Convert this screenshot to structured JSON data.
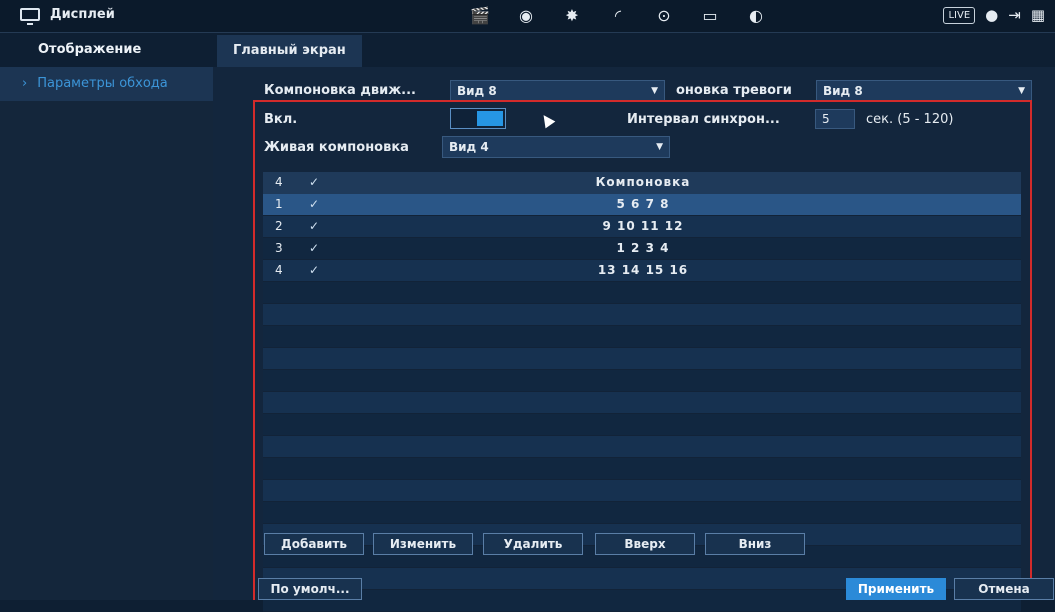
{
  "topbar": {
    "title": "Дисплей",
    "icons": [
      "clapper-icon",
      "face-icon",
      "alarm-icon",
      "speed-icon",
      "record-icon",
      "monitor-icon",
      "audio-icon"
    ],
    "live_label": "LIVE"
  },
  "sidebar": {
    "items": [
      {
        "label": "Отображение"
      },
      {
        "label": "Параметры обхода"
      }
    ]
  },
  "tabs": [
    {
      "label": "Главный экран"
    }
  ],
  "form": {
    "motion_layout_label": "Компоновка движ...",
    "motion_layout_value": "Вид 8",
    "alarm_layout_label": "оновка тревоги",
    "alarm_layout_value": "Вид 8",
    "enable_label": "Вкл.",
    "sync_interval_label": "Интервал синхрон...",
    "sync_interval_value": "5",
    "sync_interval_unit": "сек.  (5 - 120)",
    "live_layout_label": "Живая компоновка",
    "live_layout_value": "Вид 4"
  },
  "table": {
    "header": {
      "num": "4",
      "check": "✓",
      "layout": "Компоновка"
    },
    "rows": [
      {
        "num": "1",
        "check": "✓",
        "layout": "5  6  7  8"
      },
      {
        "num": "2",
        "check": "✓",
        "layout": "9 10 11 12"
      },
      {
        "num": "3",
        "check": "✓",
        "layout": "1  2  3  4"
      },
      {
        "num": "4",
        "check": "✓",
        "layout": "13 14 15 16"
      }
    ]
  },
  "buttons": {
    "add": "Добавить",
    "edit": "Изменить",
    "delete": "Удалить",
    "up": "Вверх",
    "down": "Вниз",
    "default": "По умолч...",
    "apply": "Применить",
    "cancel": "Отмена"
  },
  "colors": {
    "accent": "#2b8ad8",
    "highlight": "#d32b2b"
  }
}
